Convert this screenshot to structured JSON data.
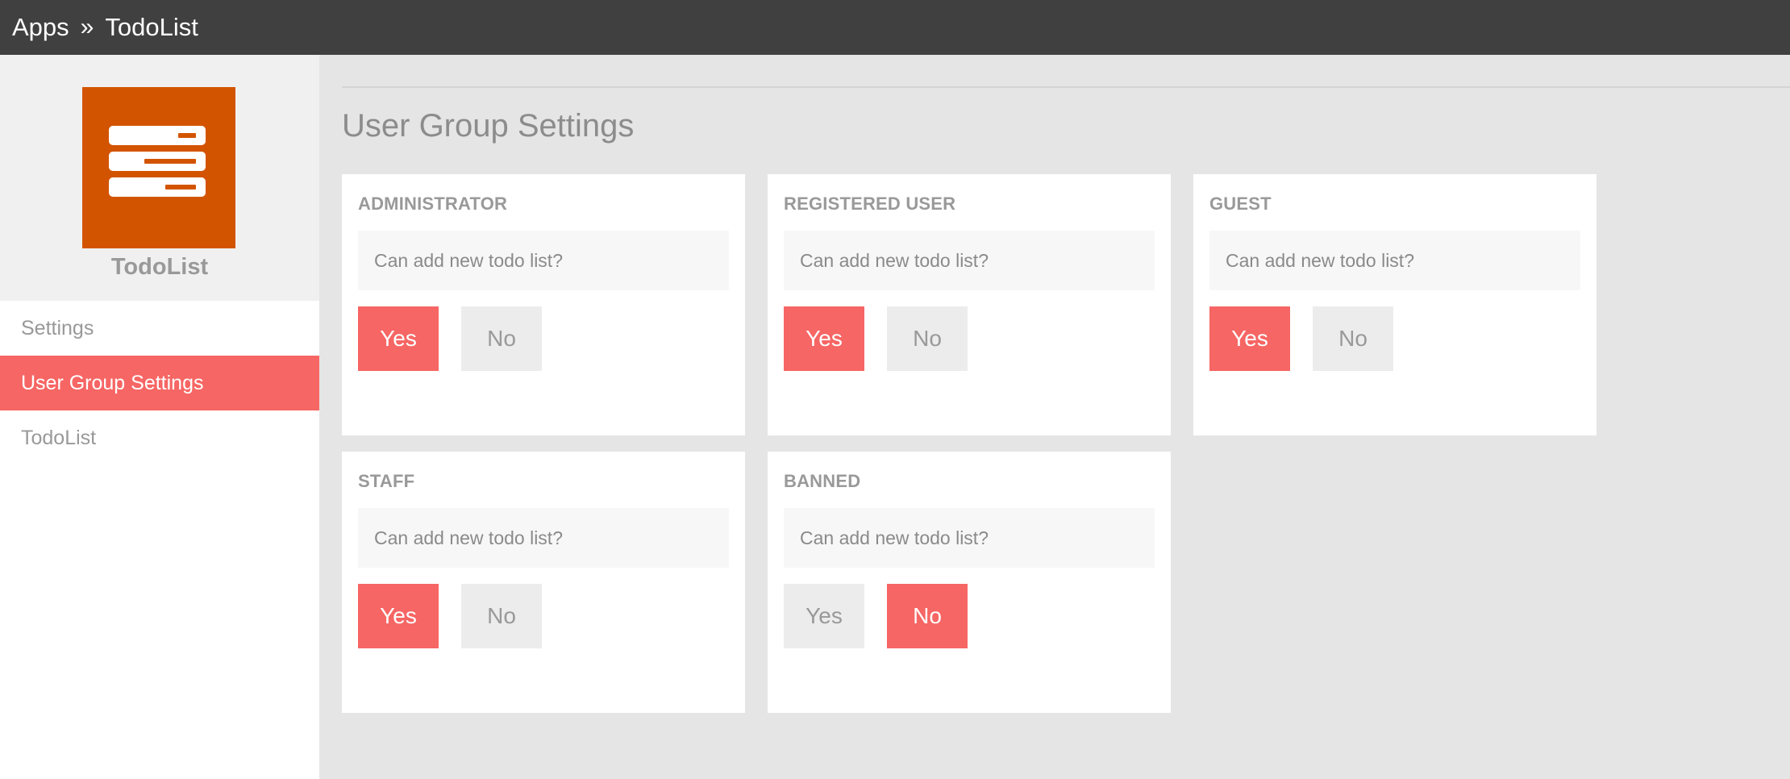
{
  "breadcrumb": {
    "root": "Apps",
    "separator": "»",
    "current": "TodoList"
  },
  "app": {
    "name": "TodoList",
    "icon": "server-rack-icon",
    "logo_color": "#d35400"
  },
  "sidebar": {
    "items": [
      {
        "label": "Settings",
        "active": false
      },
      {
        "label": "User Group Settings",
        "active": true
      },
      {
        "label": "TodoList",
        "active": false
      }
    ]
  },
  "main": {
    "title": "User Group Settings",
    "groups": [
      {
        "name": "ADMINISTRATOR",
        "question": "Can add new todo list?",
        "yes_label": "Yes",
        "no_label": "No",
        "value": "yes"
      },
      {
        "name": "REGISTERED USER",
        "question": "Can add new todo list?",
        "yes_label": "Yes",
        "no_label": "No",
        "value": "yes"
      },
      {
        "name": "GUEST",
        "question": "Can add new todo list?",
        "yes_label": "Yes",
        "no_label": "No",
        "value": "yes"
      },
      {
        "name": "STAFF",
        "question": "Can add new todo list?",
        "yes_label": "Yes",
        "no_label": "No",
        "value": "yes"
      },
      {
        "name": "BANNED",
        "question": "Can add new todo list?",
        "yes_label": "Yes",
        "no_label": "No",
        "value": "no"
      }
    ]
  },
  "colors": {
    "accent": "#f66664",
    "topbar": "#404040",
    "inactive_button": "#ececec"
  }
}
